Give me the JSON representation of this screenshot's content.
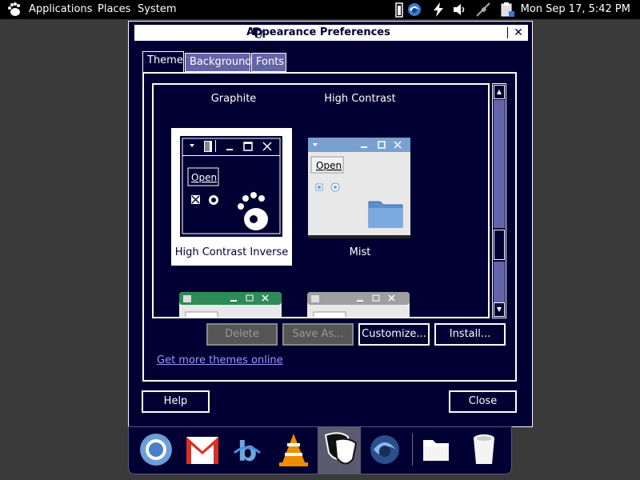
{
  "top_panel": {
    "menus": [
      "Applications",
      "Places",
      "System"
    ],
    "clock": "Mon Sep 17,  5:42 PM",
    "tray_icons": [
      "battery-icon",
      "network-swirl-icon",
      "power-bolt-icon",
      "volume-icon",
      "wired-network-icon",
      "clipboard-icon"
    ]
  },
  "window": {
    "title": "Appearance Preferences",
    "tabs": [
      "Theme",
      "Background",
      "Fonts"
    ],
    "active_tab": "Theme",
    "themes": [
      {
        "name": "Graphite"
      },
      {
        "name": "High Contrast"
      },
      {
        "name": "High Contrast Inverse",
        "selected": true
      },
      {
        "name": "Mist"
      }
    ],
    "preview_open_label": "Open",
    "buttons": {
      "delete": "Delete",
      "save_as": "Save As...",
      "customize": "Customize...",
      "install": "Install..."
    },
    "link": "Get more themes online",
    "help": "Help",
    "close": "Close"
  },
  "dock": {
    "items": [
      "chromium-icon",
      "gmail-icon",
      "browser-b-icon",
      "vlc-icon",
      "masks-icon",
      "swirl-icon",
      "folder-icon",
      "trash-icon"
    ]
  },
  "colors": {
    "window_bg": "#000033",
    "inactive_tab": "#6464aa",
    "link": "#9999ff",
    "disabled_button": "#555555"
  }
}
